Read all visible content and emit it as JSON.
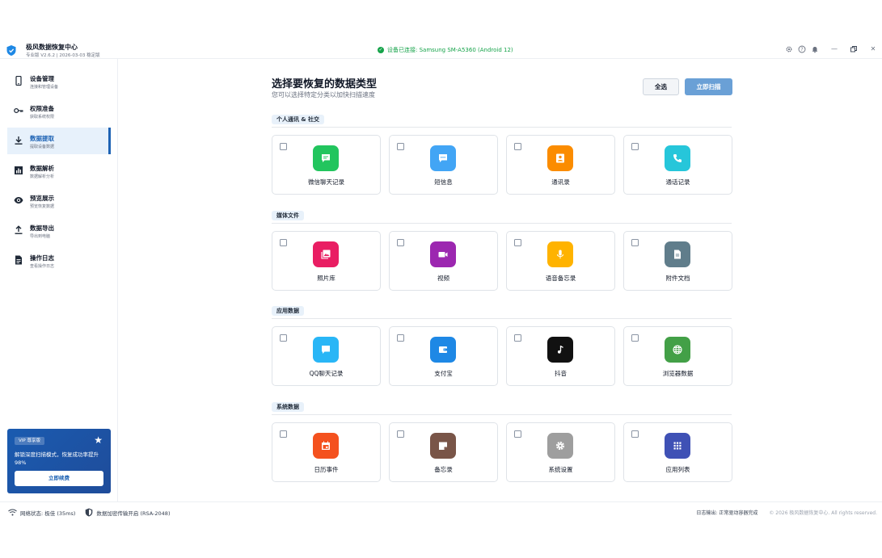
{
  "app": {
    "name": "极风数据恢复中心",
    "version": "专业版 V2.6.2 | 2026-03-03 稳定版",
    "connection": "设备已连接: Samsung SM-A5360 (Android 12)"
  },
  "titlebar": {
    "icons": [
      "gear-icon",
      "help-icon",
      "bell-icon"
    ],
    "window_controls": [
      "minimize",
      "restore",
      "close"
    ]
  },
  "sidebar": {
    "items": [
      {
        "label": "设备管理",
        "sub": "连接和管理设备",
        "icon": "phone-icon",
        "active": false
      },
      {
        "label": "权限准备",
        "sub": "获取系统权限",
        "icon": "key-icon",
        "active": false
      },
      {
        "label": "数据提取",
        "sub": "提取设备数据",
        "icon": "download-icon",
        "active": true
      },
      {
        "label": "数据解析",
        "sub": "数据解析分析",
        "icon": "chart-icon",
        "active": false
      },
      {
        "label": "预览展示",
        "sub": "预览恢复数据",
        "icon": "eye-icon",
        "active": false
      },
      {
        "label": "数据导出",
        "sub": "导出到电脑",
        "icon": "upload-icon",
        "active": false
      },
      {
        "label": "操作日志",
        "sub": "查看操作日志",
        "icon": "log-icon",
        "active": false
      }
    ],
    "vip": {
      "badge": "VIP 尊享版",
      "text": "解锁深度扫描模式，恢复成功率提升98%",
      "button": "立即续费"
    }
  },
  "main": {
    "title": "选择要恢复的数据类型",
    "subtitle": "您可以选择特定分类以加快扫描速度",
    "select_all": "全选",
    "scan_now": "立即扫描",
    "sections": [
      {
        "title": "个人通讯 & 社交",
        "items": [
          {
            "label": "微信聊天记录",
            "icon": "wechat-icon",
            "color": "#22c55e",
            "checked": false
          },
          {
            "label": "短信息",
            "icon": "sms-icon",
            "color": "#42a5f5",
            "checked": false
          },
          {
            "label": "通讯录",
            "icon": "contacts-icon",
            "color": "#fb8c00",
            "checked": false
          },
          {
            "label": "通话记录",
            "icon": "phone-call-icon",
            "color": "#26c6da",
            "checked": false
          }
        ]
      },
      {
        "title": "媒体文件",
        "items": [
          {
            "label": "照片库",
            "icon": "photo-icon",
            "color": "#e91e63",
            "checked": false
          },
          {
            "label": "视频",
            "icon": "video-icon",
            "color": "#9c27b0",
            "checked": false
          },
          {
            "label": "语音备忘录",
            "icon": "mic-icon",
            "color": "#ffb300",
            "checked": false
          },
          {
            "label": "附件文档",
            "icon": "document-icon",
            "color": "#607d8b",
            "checked": false
          }
        ]
      },
      {
        "title": "应用数据",
        "items": [
          {
            "label": "QQ聊天记录",
            "icon": "qq-chat-icon",
            "color": "#29b6f6",
            "checked": false
          },
          {
            "label": "支付宝",
            "icon": "wallet-icon",
            "color": "#1e88e5",
            "checked": false
          },
          {
            "label": "抖音",
            "icon": "music-note-icon",
            "color": "#111111",
            "checked": false
          },
          {
            "label": "浏览器数据",
            "icon": "globe-icon",
            "color": "#43a047",
            "checked": false
          }
        ]
      },
      {
        "title": "系统数据",
        "items": [
          {
            "label": "日历事件",
            "icon": "calendar-icon",
            "color": "#f4511e",
            "checked": false
          },
          {
            "label": "备忘录",
            "icon": "note-icon",
            "color": "#795548",
            "checked": false
          },
          {
            "label": "系统设置",
            "icon": "settings-icon",
            "color": "#9e9e9e",
            "checked": false
          },
          {
            "label": "应用列表",
            "icon": "apps-icon",
            "color": "#3f51b5",
            "checked": false
          }
        ]
      }
    ]
  },
  "status": {
    "network": "网络状态: 极佳 (35ms)",
    "encryption": "数据加密传输开启 (RSA-2048)",
    "log": "日志输出: 正常驱动容器完成",
    "copyright": "© 2026 极风数据恢复中心. All rights reserved."
  }
}
